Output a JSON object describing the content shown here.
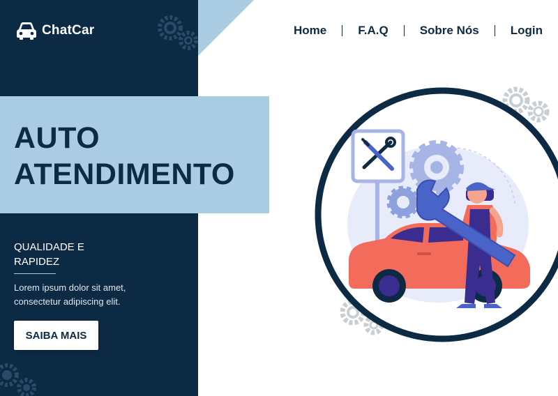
{
  "brand": {
    "name": "ChatCar",
    "icon": "car-icon"
  },
  "nav": {
    "items": [
      "Home",
      "F.A.Q",
      "Sobre Nós",
      "Login"
    ]
  },
  "hero": {
    "title_line1": "AUTO",
    "title_line2": "ATENDIMENTO",
    "subtitle_line1": "QUALIDADE E",
    "subtitle_line2": "RAPIDEZ",
    "description_line1": "Lorem ipsum dolor sit amet,",
    "description_line2": "consectetur adipiscing elit.",
    "cta_label": "SAIBA MAIS"
  },
  "colors": {
    "navy": "#0d2a45",
    "light_blue": "#aacce3",
    "car_red": "#f26b5b",
    "accent_blue": "#4a63c9",
    "gear_grey": "#c8ced4"
  }
}
